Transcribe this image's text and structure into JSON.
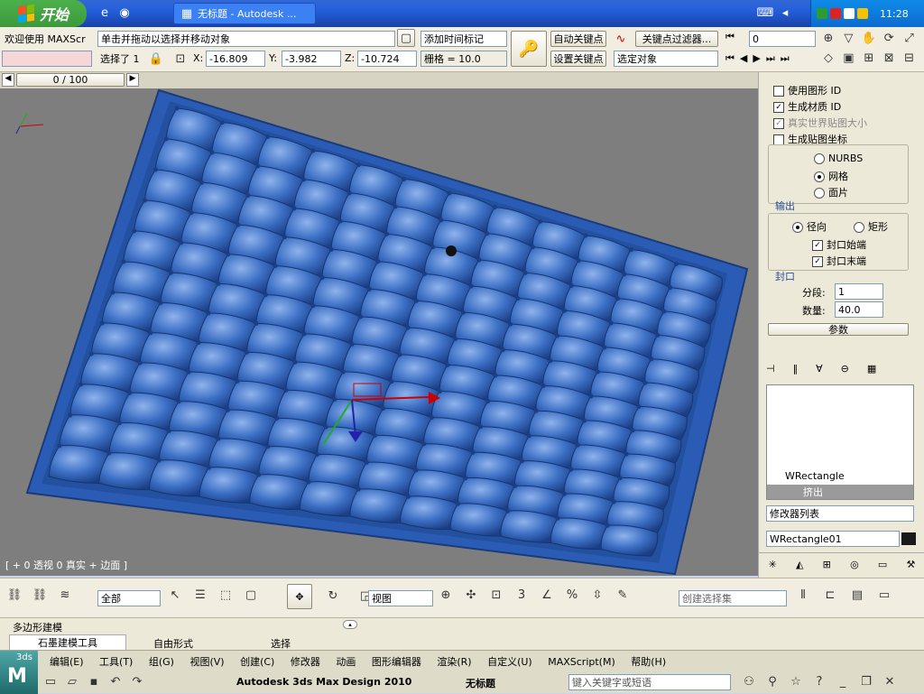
{
  "taskbar": {
    "start_label": "开始",
    "window_title": "无标题 - Autodesk ...",
    "clock": "11:28"
  },
  "toolbar": {
    "maxscript_label": "欢迎使用 MAXScr",
    "status_prompt": "单击并拖动以选择并移动对象",
    "selected_label": "选择了 1",
    "x_label": "X:",
    "x_value": "-16.809",
    "y_label": "Y:",
    "y_value": "-3.982",
    "z_label": "Z:",
    "z_value": "-10.724",
    "grid_value": "栅格 = 10.0",
    "add_time_tag": "添加时间标记",
    "auto_key": "自动关键点",
    "set_key": "设置关键点",
    "selected_object_dropdown": "选定对象",
    "key_filters": "关键点过滤器...",
    "frame_value": "0",
    "timeline_value": "0 / 100"
  },
  "viewport": {
    "label": "[ + 0 透视 0 真实 + 边面 ]",
    "tile_color": "#2f5fb0"
  },
  "command_panel": {
    "gen_mapping": "使用图形 ID",
    "gen_material": "生成材质 ID",
    "real_world": "真实世界贴图大小",
    "gen_coords": "生成贴图坐标",
    "nurbs": "NURBS",
    "grid": "网格",
    "patch": "面片",
    "output_group": "输出",
    "radial": "径向",
    "rectangular": "矩形",
    "cap_start": "封口始端",
    "cap_end": "封口末端",
    "cap_group": "封口",
    "segments_label": "分段:",
    "segments_value": "1",
    "amount_label": "数量:",
    "amount_value": "40.0",
    "params_rollout": "参数",
    "stack_items": [
      "WRectangle",
      "挤出"
    ],
    "modifier_list": "修改器列表",
    "object_name": "WRectangle01",
    "object_color": "#1a1a1a"
  },
  "main_toolbar": {
    "select_filter": "全部",
    "ref_coord": "视图",
    "named_selection": "创建选择集"
  },
  "ribbon_tabs": {
    "label_top": "多边形建模",
    "tabs": [
      "石墨建模工具",
      "自由形式",
      "选择"
    ]
  },
  "menus": {
    "items": [
      "编辑(E)",
      "工具(T)",
      "组(G)",
      "视图(V)",
      "创建(C)",
      "修改器",
      "动画",
      "图形编辑器",
      "渲染(R)",
      "自定义(U)",
      "MAXScript(M)",
      "帮助(H)"
    ],
    "title": "Autodesk 3ds Max Design 2010",
    "doc_title": "无标题",
    "search_placeholder": "键入关键字或短语",
    "app_badge": "3ds"
  }
}
